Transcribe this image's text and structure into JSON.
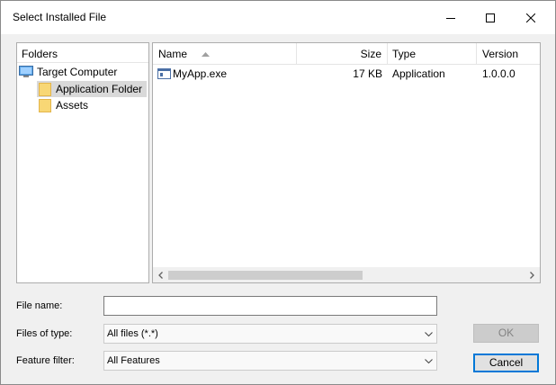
{
  "window": {
    "title": "Select Installed File",
    "controls": [
      "minimize-icon",
      "maximize-icon",
      "close-icon"
    ]
  },
  "folders_panel": {
    "header": "Folders",
    "items": [
      {
        "label": "Target Computer",
        "icon": "computer-icon",
        "selected": false
      },
      {
        "label": "Application Folder",
        "icon": "folder-icon",
        "selected": true
      },
      {
        "label": "Assets",
        "icon": "folder-icon",
        "selected": false
      }
    ]
  },
  "files_panel": {
    "columns": [
      "Name",
      "Size",
      "Type",
      "Version"
    ],
    "sort": {
      "column": "Name",
      "direction": "ascending"
    },
    "rows": [
      {
        "name": "MyApp.exe",
        "size": "17 KB",
        "type": "Application",
        "version": "1.0.0.0",
        "icon": "exe-file-icon"
      }
    ]
  },
  "form": {
    "file_name": {
      "label": "File name:",
      "value": ""
    },
    "files_of_type": {
      "label": "Files of type:",
      "value": "All files (*.*)"
    },
    "feature_filter": {
      "label": "Feature filter:",
      "value": "All Features"
    }
  },
  "buttons": {
    "ok": {
      "label": "OK",
      "enabled": false
    },
    "cancel": {
      "label": "Cancel",
      "enabled": true
    }
  },
  "colors": {
    "selection": "#d9d9d9",
    "focus_border": "#0078d7",
    "folder_yellow": "#f8d775"
  }
}
